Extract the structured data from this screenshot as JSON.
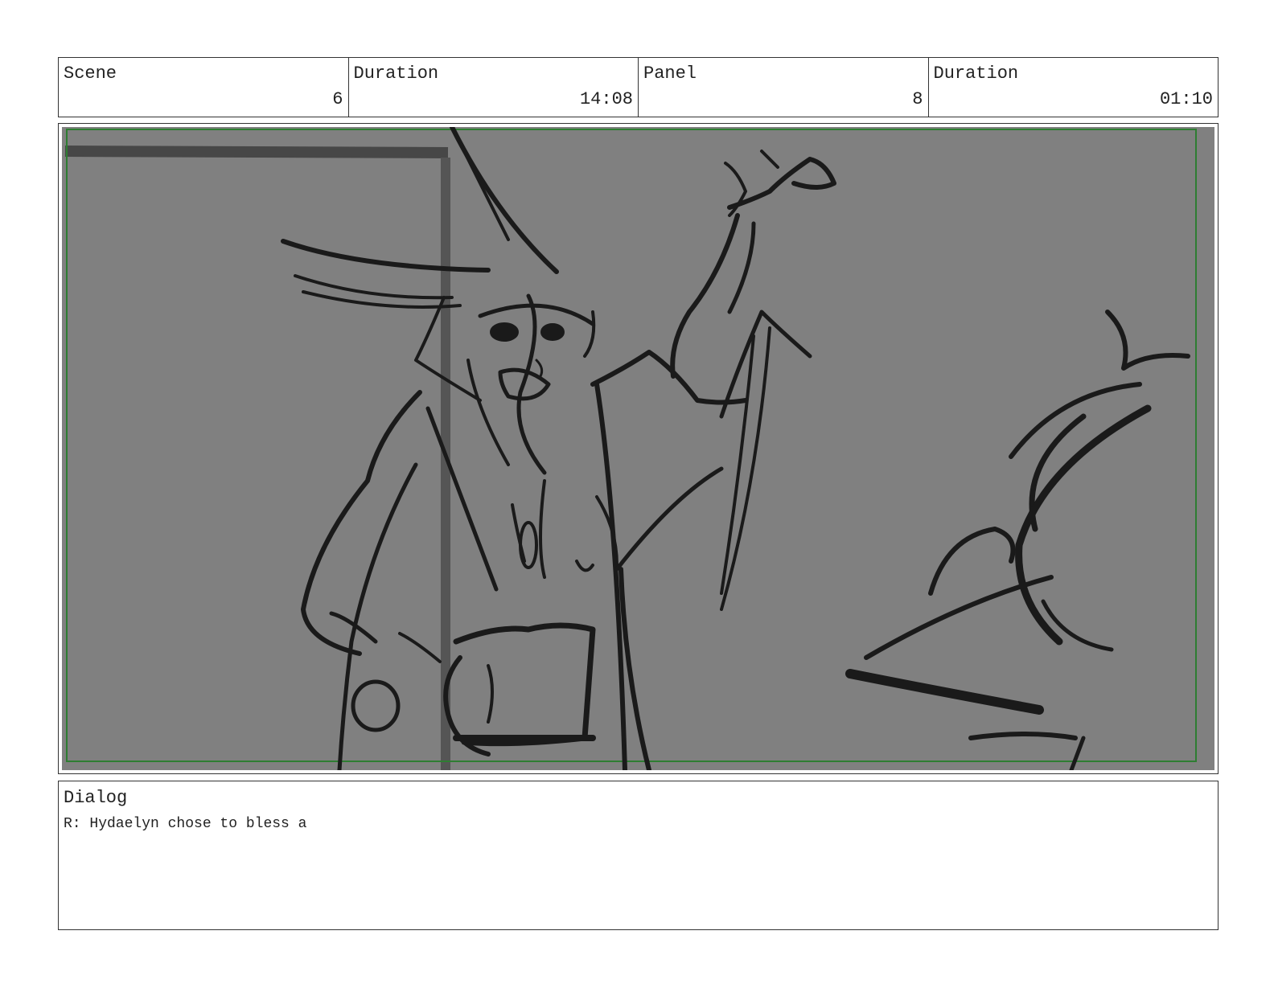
{
  "header": {
    "scene_label": "Scene",
    "scene_value": "6",
    "scene_duration_label": "Duration",
    "scene_duration_value": "14:08",
    "panel_label": "Panel",
    "panel_value": "8",
    "panel_duration_label": "Duration",
    "panel_duration_value": "01:10"
  },
  "panel_image": {
    "background_color": "#808080",
    "safe_area_color": "#2e7d32",
    "line_color": "#1a1a1a"
  },
  "dialog": {
    "title": "Dialog",
    "text": "R: Hydaelyn chose to bless a"
  }
}
